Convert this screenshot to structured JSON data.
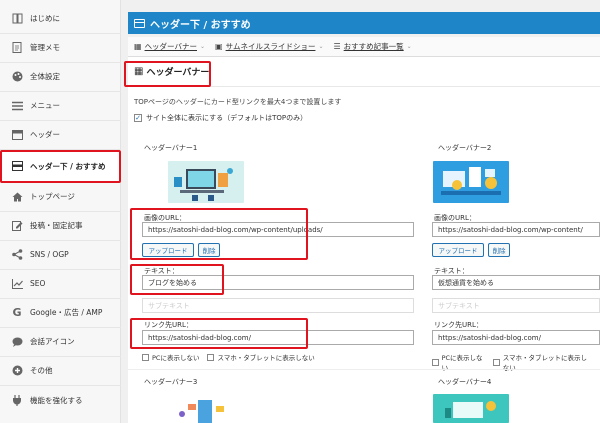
{
  "sidebar": {
    "items": [
      {
        "label": "はじめに",
        "icon": "book-icon"
      },
      {
        "label": "管理メモ",
        "icon": "document-icon"
      },
      {
        "label": "全体設定",
        "icon": "palette-icon"
      },
      {
        "label": "メニュー",
        "icon": "menu-icon"
      },
      {
        "label": "ヘッダー",
        "icon": "header-icon"
      },
      {
        "label": "ヘッダー下 / おすすめ",
        "icon": "header-below-icon",
        "active": true
      },
      {
        "label": "トップページ",
        "icon": "home-icon"
      },
      {
        "label": "投稿・固定記事",
        "icon": "edit-icon"
      },
      {
        "label": "SNS / OGP",
        "icon": "share-icon"
      },
      {
        "label": "SEO",
        "icon": "chart-icon"
      },
      {
        "label": "Google・広告 / AMP",
        "icon": "google-icon"
      },
      {
        "label": "会話アイコン",
        "icon": "chat-icon"
      },
      {
        "label": "その他",
        "icon": "plus-circle-icon"
      },
      {
        "label": "機能を強化する",
        "icon": "plug-icon"
      }
    ]
  },
  "topbar": {
    "title": "ヘッダー下 / おすすめ"
  },
  "crumbs": [
    {
      "label": "ヘッダーバナー"
    },
    {
      "label": "サムネイルスライドショー"
    },
    {
      "label": "おすすめ記事一覧"
    }
  ],
  "section": {
    "title": "ヘッダーバナー",
    "description": "TOPページのヘッダーにカード型リンクを最大4つまで設置します",
    "sitewide_label": "サイト全体に表示にする（デフォルトはTOPのみ）",
    "sitewide_checked": true
  },
  "banners": [
    {
      "title": "ヘッダーバナー1",
      "image_label": "画像のURL：",
      "image_url": "https://satoshi-dad-blog.com/wp-content/uploads/",
      "upload_label": "アップロード",
      "delete_label": "削除",
      "text_label": "テキスト：",
      "text_value": "ブログを始める",
      "subtext_placeholder": "サブテキスト",
      "link_label": "リンク先URL：",
      "link_url": "https://satoshi-dad-blog.com/",
      "hide_pc_label": "PCに表示しない",
      "hide_sp_label": "スマホ・タブレットに表示しない"
    },
    {
      "title": "ヘッダーバナー2",
      "image_label": "画像のURL：",
      "image_url": "https://satoshi-dad-blog.com/wp-content/",
      "upload_label": "アップロード",
      "delete_label": "削除",
      "text_label": "テキスト：",
      "text_value": "仮想通貨を始める",
      "subtext_placeholder": "サブテキスト",
      "link_label": "リンク先URL：",
      "link_url": "https://satoshi-dad-blog.com/",
      "hide_pc_label": "PCに表示しない",
      "hide_sp_label": "スマホ・タブレットに表示しない"
    },
    {
      "title": "ヘッダーバナー3"
    },
    {
      "title": "ヘッダーバナー4"
    }
  ],
  "colors": {
    "accent": "#1d85c8",
    "highlight": "#e0141e",
    "button": "#2271b1"
  }
}
